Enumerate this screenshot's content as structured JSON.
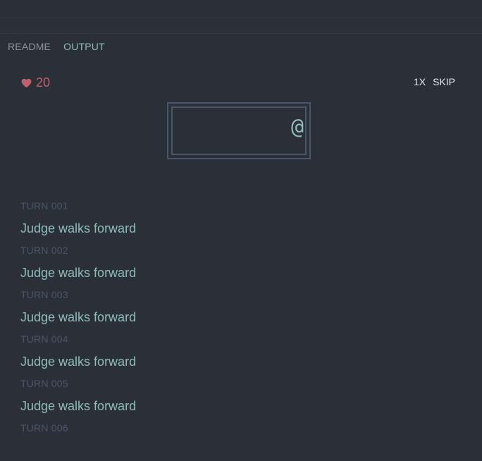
{
  "tabs": [
    {
      "label": "README",
      "active": false
    },
    {
      "label": "OUTPUT",
      "active": true
    }
  ],
  "status": {
    "lives": "20",
    "heart_color": "#bf616a"
  },
  "controls": {
    "speed_label": "1X",
    "skip_label": "SKIP"
  },
  "board": {
    "player_glyph": "@",
    "player_color": "#8fbcbb"
  },
  "log": [
    {
      "turn": "TURN 001",
      "message": "Judge walks forward"
    },
    {
      "turn": "TURN 002",
      "message": "Judge walks forward"
    },
    {
      "turn": "TURN 003",
      "message": "Judge walks forward"
    },
    {
      "turn": "TURN 004",
      "message": "Judge walks forward"
    },
    {
      "turn": "TURN 005",
      "message": "Judge walks forward"
    },
    {
      "turn": "TURN 006",
      "message": ""
    }
  ],
  "colors": {
    "background": "#2a2f38",
    "accent": "#8fbcbb",
    "muted": "#4c566a"
  }
}
